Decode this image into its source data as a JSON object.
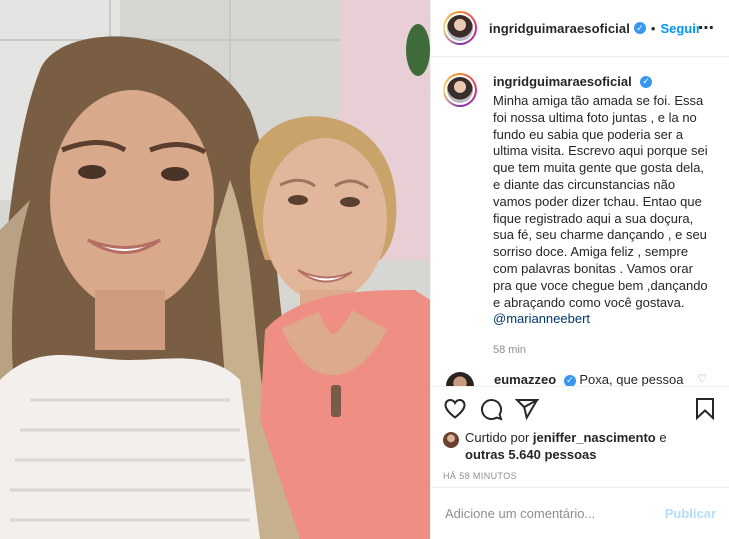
{
  "colors": {
    "accent": "#0095f6",
    "verified": "#3897f0",
    "muted": "#8e8e8e",
    "publish_disabled": "#b2dffc",
    "mention": "#00376b"
  },
  "header": {
    "username": "ingridguimaraesoficial",
    "separator": "•",
    "follow_label": "Seguir",
    "more_icon": "⋯"
  },
  "caption": {
    "username": "ingridguimaraesoficial",
    "text": "Minha amiga tão amada se foi. Essa foi nossa ultima foto juntas , e la no fundo eu sabia que poderia ser a ultima visita. Escrevo aqui porque sei que tem muita gente que gosta dela, e diante das circunstancias não vamos poder dizer tchau. Entao que fique registrado aqui a sua doçura, sua fé, seu charme dançando , e seu sorriso doce. Amiga feliz , sempre com palavras bonitas . Vamos orar pra que voce chegue bem ,dançando e abraçando como você gostava.",
    "mention": "@marianneebert",
    "time": "58 min"
  },
  "comment": {
    "username": "eumazzeo",
    "text": "Poxa, que pessoa"
  },
  "actions": {
    "like_icon": "heart-icon",
    "comment_icon": "comment-icon",
    "share_icon": "share-icon",
    "save_icon": "bookmark-icon"
  },
  "likes": {
    "prefix": "Curtido por ",
    "liker": "jeniffer_nascimento",
    "connector": " e",
    "others": "outras 5.640 pessoas"
  },
  "timeago": "HÁ 58 MINUTOS",
  "add_comment": {
    "placeholder": "Adicione um comentário...",
    "publish_label": "Publicar"
  }
}
